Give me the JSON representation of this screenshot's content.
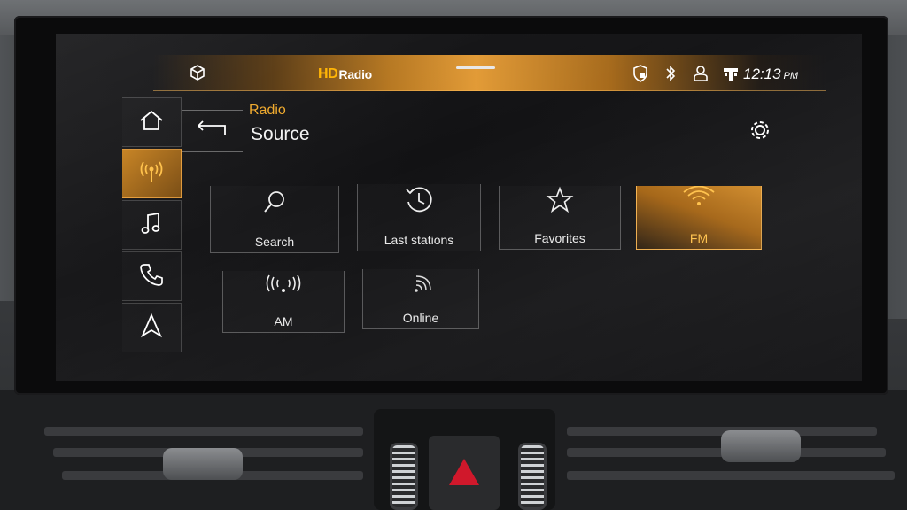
{
  "statusbar": {
    "brand": "Radio",
    "brand_prefix": "HD",
    "time": "12:13",
    "ampm": "PM",
    "icons": [
      "cube-icon",
      "privacy-shield-icon",
      "bluetooth-icon",
      "user-profile-icon",
      "signal-strength-icon"
    ]
  },
  "sidenav": {
    "items": [
      {
        "icon": "home-icon"
      },
      {
        "icon": "radio-antenna-icon",
        "active": true
      },
      {
        "icon": "music-note-icon"
      },
      {
        "icon": "phone-icon"
      },
      {
        "icon": "navigation-arrow-icon"
      }
    ]
  },
  "header": {
    "breadcrumb": "Radio",
    "title": "Source"
  },
  "sources": [
    {
      "label": "Search",
      "icon": "search-icon"
    },
    {
      "label": "Last stations",
      "icon": "history-clock-icon"
    },
    {
      "label": "Favorites",
      "icon": "star-icon"
    },
    {
      "label": "FM",
      "icon": "fm-signal-icon",
      "active": true
    },
    {
      "label": "AM",
      "icon": "am-signal-icon"
    },
    {
      "label": "Online",
      "icon": "online-signal-icon"
    }
  ],
  "colors": {
    "accent": "#f0a92b",
    "active_tile": "#c78221",
    "text": "#eaeaea"
  }
}
